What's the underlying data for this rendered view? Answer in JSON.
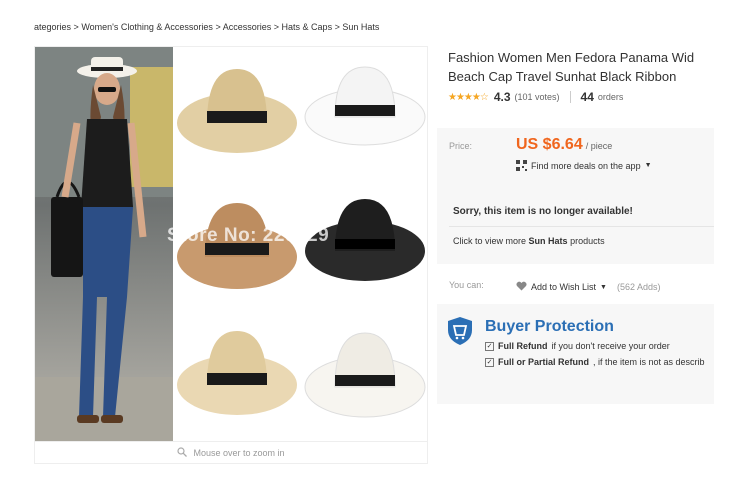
{
  "breadcrumb": {
    "items": [
      "ategories",
      "Women's Clothing & Accessories",
      "Accessories",
      "Hats & Caps",
      "Sun Hats"
    ],
    "separator": ">"
  },
  "gallery": {
    "watermark": "Store No: 229629",
    "zoom_hint": "Mouse over to zoom in"
  },
  "product": {
    "title_line1": "Fashion Women Men Fedora Panama Wid",
    "title_line2": "Beach Cap Travel Sunhat Black Ribbon",
    "rating": "4.3",
    "votes": "(101 votes)",
    "orders_count": "44",
    "orders_label": "orders"
  },
  "price": {
    "label": "Price:",
    "value": "US $6.64",
    "per": "/ piece",
    "deals": "Find more deals on the app",
    "unavailable": "Sorry, this item is no longer available!",
    "view_more_prefix": "Click to view more",
    "view_more_link": "Sun Hats",
    "view_more_suffix": "products"
  },
  "wishlist": {
    "label": "You can:",
    "action": "Add to Wish List",
    "count": "(562 Adds)"
  },
  "protection": {
    "title": "Buyer Protection",
    "item1_bold": "Full Refund",
    "item1_text": "if you don't receive your order",
    "item2_bold": "Full or Partial Refund",
    "item2_text": ", if the item is not as describ"
  },
  "colors": {
    "accent": "#f0661e",
    "protection_blue": "#2b6fb5",
    "stars": "#f5a623"
  }
}
